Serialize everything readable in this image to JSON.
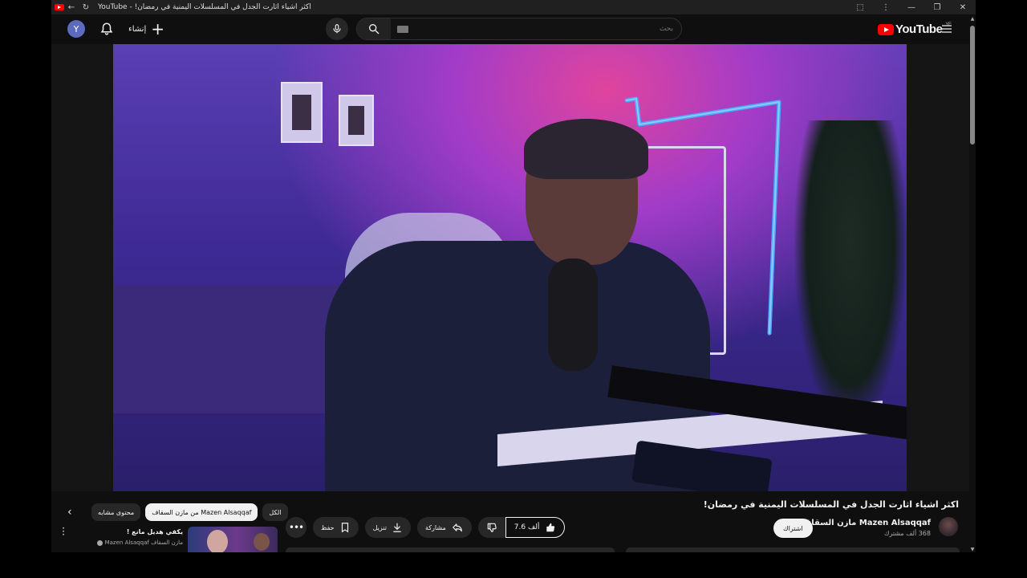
{
  "window": {
    "title": "YouTube - !اكثر اشياء اثارت الجدل في المسلسلات اليمنية في رمضان",
    "controls": {
      "minimize": "—",
      "restore": "❐",
      "close": "✕"
    }
  },
  "header": {
    "avatar_letter": "Y",
    "create_label": "إنشاء",
    "search_placeholder": "بحث",
    "logo_text": "YouTube",
    "logo_region": "YE"
  },
  "video": {
    "title": "اكثر اشياء اثارت الجدل في المسلسلات اليمنية في رمضان!",
    "channel_name": "Mazen Alsaqqaf مازن السقاف",
    "subscribers": "368 ألف مشترك",
    "subscribe_label": "اشتراك",
    "like_count": "7.6 ألف",
    "share_label": "مشاركة",
    "download_label": "تنزيل",
    "save_label": "حفظ"
  },
  "sidebar": {
    "chips": [
      "محتوى مشابه",
      "من مازن السقاف Mazen Alsaqqaf",
      "الكل"
    ],
    "active_chip_index": 1,
    "recommendation": {
      "title": "يكفي هديل مانع !",
      "channel": "مازن السقاف Mazen Alsaqqaf"
    }
  }
}
